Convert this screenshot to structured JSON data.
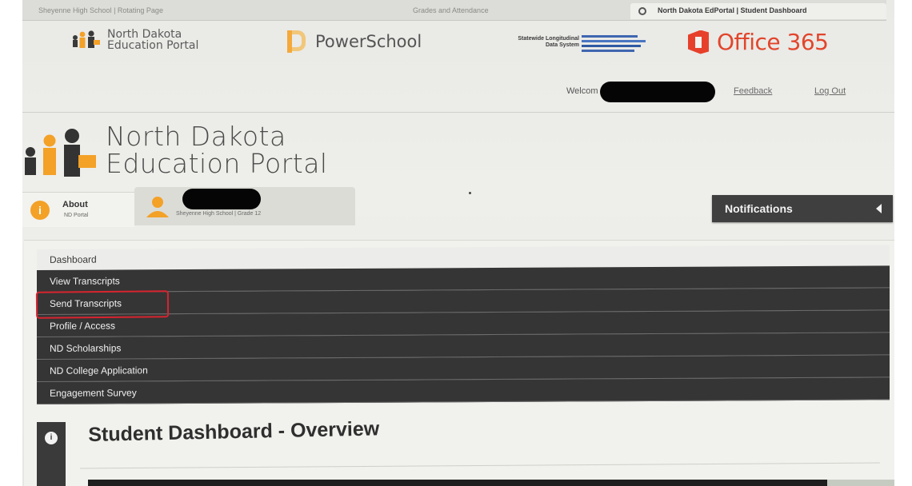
{
  "browser_tabs": [
    {
      "label": "Sheyenne High School | Rotating Page"
    },
    {
      "label": "Grades and Attendance"
    },
    {
      "label": "North Dakota EdPortal | Student Dashboard"
    }
  ],
  "top_links": {
    "nd_portal": {
      "line1": "North Dakota",
      "line2": "Education Portal"
    },
    "powerschool": "PowerSchool",
    "slds": {
      "line1": "Statewide Longitudinal",
      "line2": "Data System"
    },
    "office365": "Office 365"
  },
  "user_bar": {
    "welcome": "Welcom",
    "feedback": "Feedback",
    "logout": "Log Out"
  },
  "brand": {
    "line1": "North Dakota",
    "line2": "Education Portal"
  },
  "about_tab": {
    "icon": "i",
    "title": "About",
    "subtitle": "ND Portal"
  },
  "student_tab": {
    "subtitle": "Sheyenne High School | Grade 12"
  },
  "notifications": {
    "label": "Notifications"
  },
  "nav": {
    "items": [
      {
        "label": "Dashboard",
        "active": true
      },
      {
        "label": "View Transcripts"
      },
      {
        "label": "Send Transcripts"
      },
      {
        "label": "Profile / Access"
      },
      {
        "label": "ND Scholarships"
      },
      {
        "label": "ND College Application"
      },
      {
        "label": "Engagement Survey"
      }
    ]
  },
  "overview": {
    "title": "Student Dashboard - Overview",
    "info_icon": "i"
  },
  "colors": {
    "accent_orange": "#f3a127",
    "nav_dark": "#353535",
    "highlight_red": "#d8242f",
    "office_red": "#e2452c"
  }
}
